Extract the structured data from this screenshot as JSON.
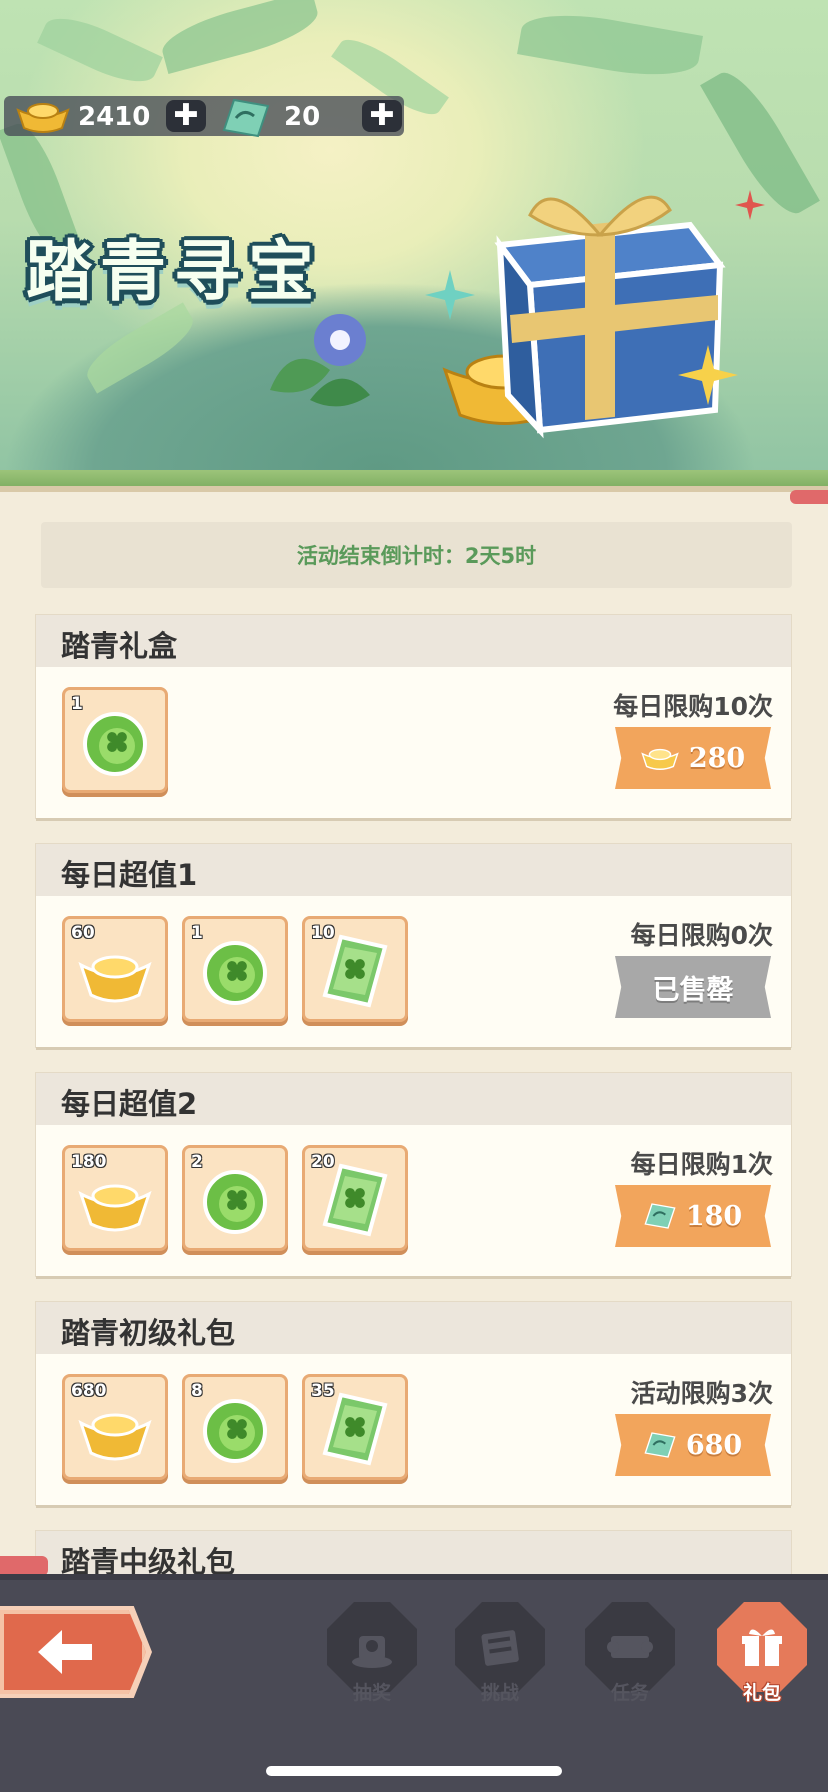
{
  "currency": {
    "gold_value": "2410",
    "ticket_value": "20",
    "gold_icon": "gold-ingot-icon",
    "ticket_icon": "ticket-icon",
    "plus_symbol": "✚"
  },
  "banner": {
    "title": "踏青寻宝"
  },
  "countdown": {
    "text": "活动结束倒计时：2天5时"
  },
  "packs": [
    {
      "title": "踏青礼盒",
      "items": [
        {
          "icon": "clover-token-icon",
          "qty": "1"
        }
      ],
      "limit": "每日限购10次",
      "price_icon": "gold-ingot-icon",
      "price": "280",
      "sold_out": false
    },
    {
      "title": "每日超值1",
      "items": [
        {
          "icon": "gold-ingot-icon",
          "qty": "60"
        },
        {
          "icon": "clover-token-icon",
          "qty": "1"
        },
        {
          "icon": "clover-ticket-icon",
          "qty": "10"
        }
      ],
      "limit": "每日限购0次",
      "price": "已售罄",
      "sold_out": true
    },
    {
      "title": "每日超值2",
      "items": [
        {
          "icon": "gold-ingot-icon",
          "qty": "180"
        },
        {
          "icon": "clover-token-icon",
          "qty": "2"
        },
        {
          "icon": "clover-ticket-icon",
          "qty": "20"
        }
      ],
      "limit": "每日限购1次",
      "price_icon": "ticket-icon",
      "price": "180",
      "sold_out": false
    },
    {
      "title": "踏青初级礼包",
      "items": [
        {
          "icon": "gold-ingot-icon",
          "qty": "680"
        },
        {
          "icon": "clover-token-icon",
          "qty": "8"
        },
        {
          "icon": "clover-ticket-icon",
          "qty": "35"
        }
      ],
      "limit": "活动限购3次",
      "price_icon": "ticket-icon",
      "price": "680",
      "sold_out": false
    },
    {
      "title": "踏青中级礼包"
    }
  ],
  "nav": {
    "back_icon": "back-arrow-icon",
    "items": [
      {
        "label": "抽奖",
        "icon": "lottery-icon",
        "active": false
      },
      {
        "label": "挑战",
        "icon": "challenge-icon",
        "active": false
      },
      {
        "label": "任务",
        "icon": "task-icon",
        "active": false
      },
      {
        "label": "礼包",
        "icon": "gift-icon",
        "active": true
      }
    ]
  },
  "colors": {
    "accent_orange": "#f2a55c",
    "countdown_green": "#5a9a5a",
    "sold_out_gray": "#a8a8a8",
    "nav_active": "#e57a5a"
  }
}
